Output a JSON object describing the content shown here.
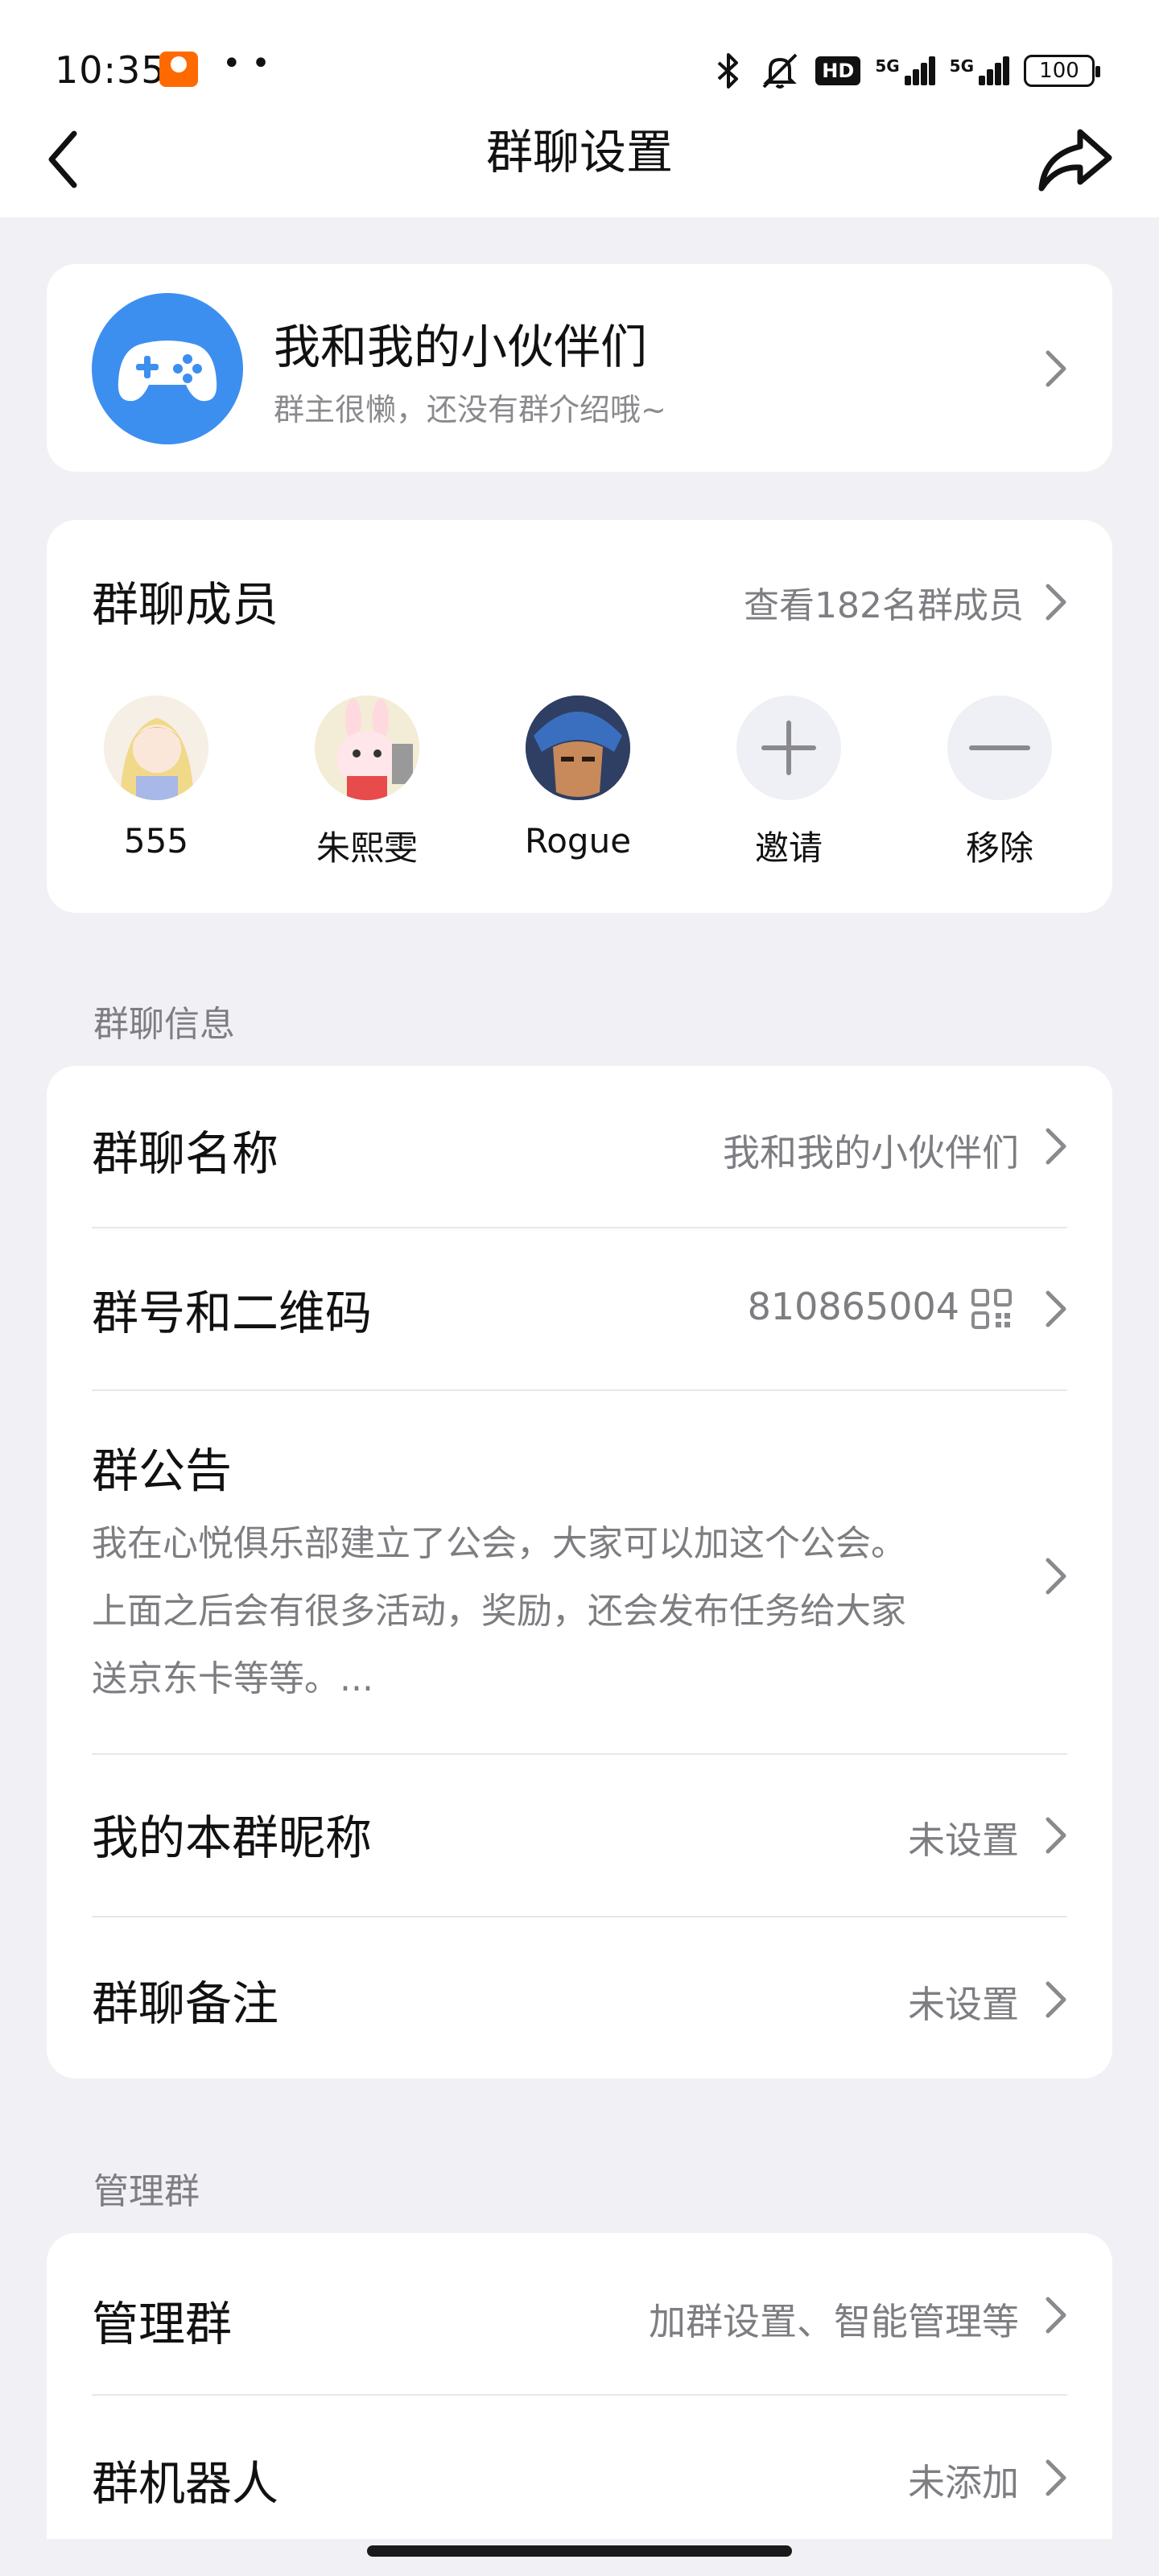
{
  "status_bar": {
    "time": "10:35",
    "dots": "• •",
    "hd": "HD",
    "sim1": "5G",
    "sim2": "5G",
    "battery": "100"
  },
  "nav": {
    "title": "群聊设置"
  },
  "group": {
    "name": "我和我的小伙伴们",
    "intro": "群主很懒，还没有群介绍哦~"
  },
  "members": {
    "title": "群聊成员",
    "view_all": "查看182名群成员",
    "list": [
      {
        "name": "555"
      },
      {
        "name": "朱熙雯"
      },
      {
        "name": "Rogue"
      }
    ],
    "invite_label": "邀请",
    "remove_label": "移除"
  },
  "sections": {
    "info": "群聊信息",
    "manage": "管理群"
  },
  "info_rows": {
    "name_title": "群聊名称",
    "name_value": "我和我的小伙伴们",
    "number_title": "群号和二维码",
    "number_value": "810865004",
    "notice_title": "群公告",
    "notice_line1": "我在心悦俱乐部建立了公会，大家可以加这个公会。",
    "notice_line2": "上面之后会有很多活动，奖励，还会发布任务给大家",
    "notice_line3": "送京东卡等等。...",
    "nickname_title": "我的本群昵称",
    "nickname_value": "未设置",
    "remark_title": "群聊备注",
    "remark_value": "未设置"
  },
  "manage_rows": {
    "manage_title": "管理群",
    "manage_value": "加群设置、智能管理等",
    "bot_title": "群机器人",
    "bot_value": "未添加"
  },
  "colors": {
    "accent": "#3d8fef",
    "background": "#f0f0f5",
    "secondary_text": "#7d7d82"
  }
}
